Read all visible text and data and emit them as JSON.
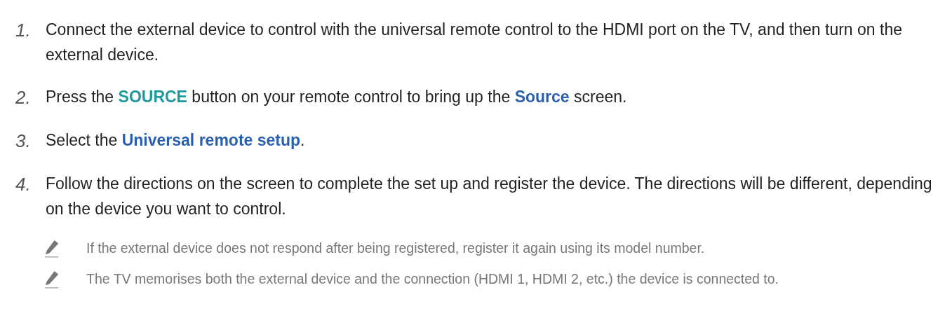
{
  "steps": [
    {
      "number": "1.",
      "parts": [
        {
          "kind": "plain",
          "text": "Connect the external device to control with the universal remote control to the HDMI port on the TV, and then turn on the external device."
        }
      ]
    },
    {
      "number": "2.",
      "parts": [
        {
          "kind": "plain",
          "text": "Press the "
        },
        {
          "kind": "button",
          "text": "SOURCE"
        },
        {
          "kind": "plain",
          "text": " button on your remote control to bring up the "
        },
        {
          "kind": "menu",
          "text": "Source"
        },
        {
          "kind": "plain",
          "text": " screen."
        }
      ]
    },
    {
      "number": "3.",
      "parts": [
        {
          "kind": "plain",
          "text": "Select the "
        },
        {
          "kind": "menu",
          "text": "Universal remote setup"
        },
        {
          "kind": "plain",
          "text": "."
        }
      ]
    },
    {
      "number": "4.",
      "parts": [
        {
          "kind": "plain",
          "text": "Follow the directions on the screen to complete the set up and register the device. The directions will be different, depending on the device you want to control."
        }
      ]
    }
  ],
  "notes": [
    "If the external device does not respond after being registered, register it again using its model number.",
    "The TV memorises both the external device and the connection (HDMI 1, HDMI 2, etc.) the device is connected to."
  ]
}
